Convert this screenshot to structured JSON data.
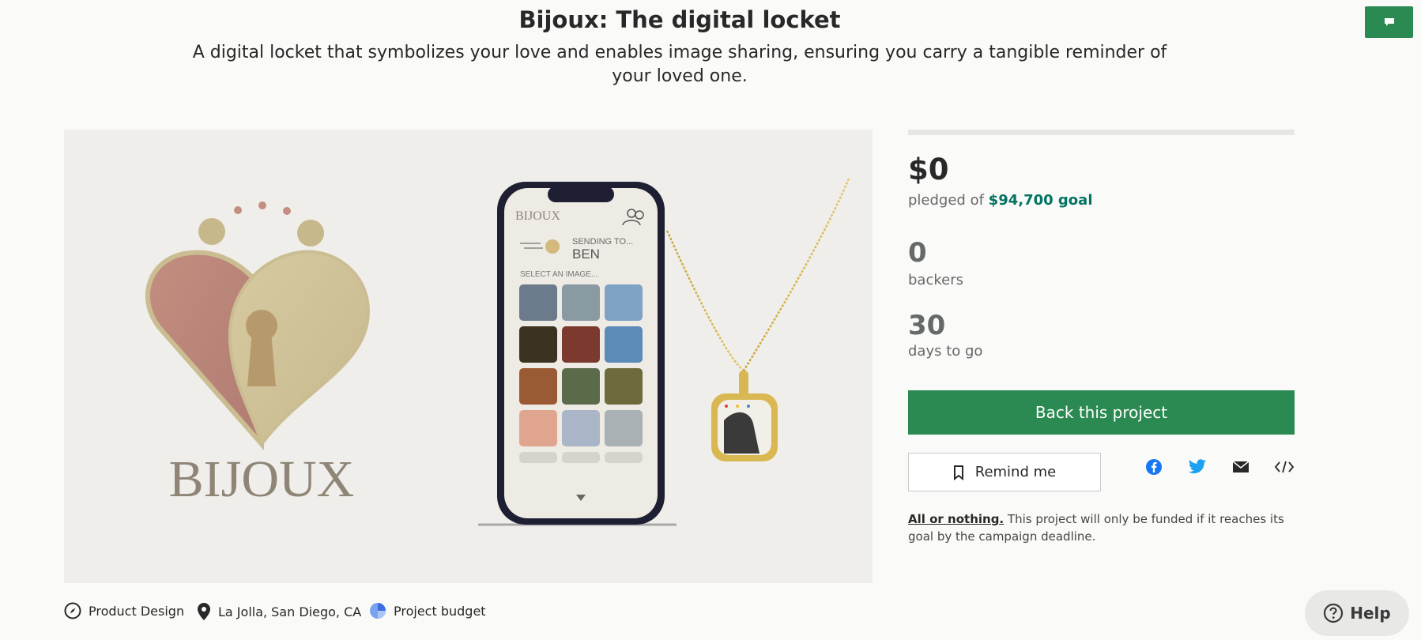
{
  "project": {
    "title": "Bijoux: The digital locket",
    "subtitle": "A digital locket that symbolizes your love and enables image sharing, ensuring you carry a tangible reminder of your loved one."
  },
  "hero": {
    "logo_text": "BIJOUX",
    "phone": {
      "brand": "BIJOUX",
      "sending_to": "SENDING TO...",
      "recipient": "BEN",
      "select_prompt": "SELECT AN IMAGE..."
    }
  },
  "stats": {
    "progress_fraction": 0,
    "pledged_amount": "$0",
    "pledged_prefix": "pledged of",
    "goal": "$94,700 goal",
    "backers_count": "0",
    "backers_label": "backers",
    "days_count": "30",
    "days_label": "days to go"
  },
  "actions": {
    "back_label": "Back this project",
    "remind_label": "Remind me"
  },
  "share_icons": [
    "facebook-icon",
    "twitter-icon",
    "email-icon",
    "embed-icon"
  ],
  "funding_note": {
    "strong": "All or nothing.",
    "text": " This project will only be funded if it reaches its goal by the campaign deadline."
  },
  "meta": {
    "category": "Product Design",
    "location": "La Jolla, San Diego, CA",
    "budget": "Project budget"
  },
  "help": {
    "label": "Help"
  },
  "colors": {
    "accent": "#2a8a52",
    "goal": "#037362",
    "facebook": "#1877f2",
    "twitter": "#1da1f2"
  }
}
